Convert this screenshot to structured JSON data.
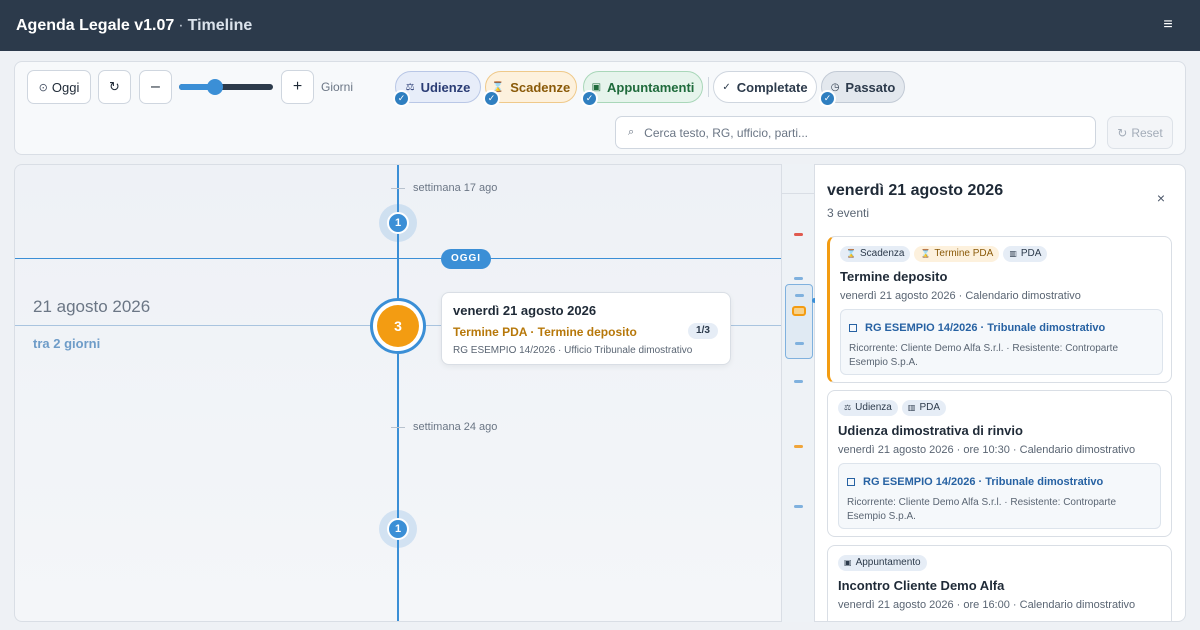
{
  "header": {
    "app_name": "Agenda Legale v1.07",
    "separator": "·",
    "view": "Timeline",
    "menu_icon": "≡"
  },
  "toolbar": {
    "today_label": "Oggi",
    "today_icon": "⊙",
    "refresh_icon": "↻",
    "minus_label": "–",
    "plus_label": "+",
    "zoom_unit": "Giorni",
    "zoom_level_fraction": 0.38,
    "filters": {
      "udienze": {
        "label": "Udienze",
        "icon": "⚖",
        "checked": true
      },
      "scadenze": {
        "label": "Scadenze",
        "icon": "⌛",
        "checked": true
      },
      "appuntamenti": {
        "label": "Appuntamenti",
        "icon": "▣",
        "checked": true
      },
      "completate": {
        "label": "Completate",
        "icon": "✓",
        "checked": false
      },
      "passato": {
        "label": "Passato",
        "icon": "◷",
        "checked": true
      }
    },
    "check_glyph": "✓",
    "search_placeholder": "Cerca testo, RG, ufficio, parti...",
    "search_value": "",
    "search_icon": "⌕",
    "reset_icon": "↻",
    "reset_label": "Reset"
  },
  "timeline": {
    "weeks": [
      "settimana 17 ago",
      "settimana 24 ago"
    ],
    "week_counts": [
      "1",
      "1"
    ],
    "today_badge": "OGGI",
    "selected_date": "21 agosto 2026",
    "relative": "tra 2 giorni",
    "selected_count": "3",
    "card": {
      "title": "venerdì 21 agosto 2026",
      "event": "Termine PDA · Termine deposito",
      "detail": "RG ESEMPIO 14/2026 · Ufficio Tribunale dimostrativo",
      "counter": "1/3"
    }
  },
  "colors": {
    "accent": "#3b8fd6",
    "deadline": "#f39c12",
    "header": "#2c3a4b",
    "danger": "#e05a4f"
  },
  "panel": {
    "title": "venerdì 21 agosto 2026",
    "count": "3 eventi",
    "close_icon": "×",
    "events": [
      {
        "tags": [
          {
            "icon": "⌛",
            "label": "Scadenza"
          },
          {
            "icon": "⌛",
            "label": "Termine PDA"
          },
          {
            "icon": "▥",
            "label": "PDA"
          }
        ],
        "title": "Termine deposito",
        "subtitle": "venerdì 21 agosto 2026 · Calendario dimostrativo",
        "case": "RG ESEMPIO 14/2026 · Tribunale dimostrativo",
        "parties": "Ricorrente: Cliente Demo Alfa S.r.l. · Resistente: Controparte Esempio S.p.A."
      },
      {
        "tags": [
          {
            "icon": "⚖",
            "label": "Udienza"
          },
          {
            "icon": "▥",
            "label": "PDA"
          }
        ],
        "title": "Udienza dimostrativa di rinvio",
        "subtitle": "venerdì 21 agosto 2026 · ore 10:30 · Calendario dimostrativo",
        "case": "RG ESEMPIO 14/2026 · Tribunale dimostrativo",
        "parties": "Ricorrente: Cliente Demo Alfa S.r.l. · Resistente: Controparte Esempio S.p.A."
      },
      {
        "tags": [
          {
            "icon": "▣",
            "label": "Appuntamento"
          }
        ],
        "title": "Incontro Cliente Demo Alfa",
        "subtitle": "venerdì 21 agosto 2026 · ore 16:00 · Calendario dimostrativo"
      }
    ]
  }
}
